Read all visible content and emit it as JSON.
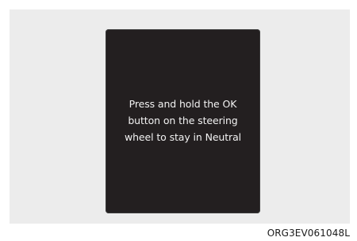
{
  "display": {
    "message_lines": [
      "Press and hold the OK",
      "button on the steering",
      "wheel to stay in Neutral"
    ]
  },
  "figure_code": "ORG3EV061048L",
  "colors": {
    "panel_background": "#ececec",
    "display_background": "#231f20",
    "message_text": "#f2f2f2"
  }
}
